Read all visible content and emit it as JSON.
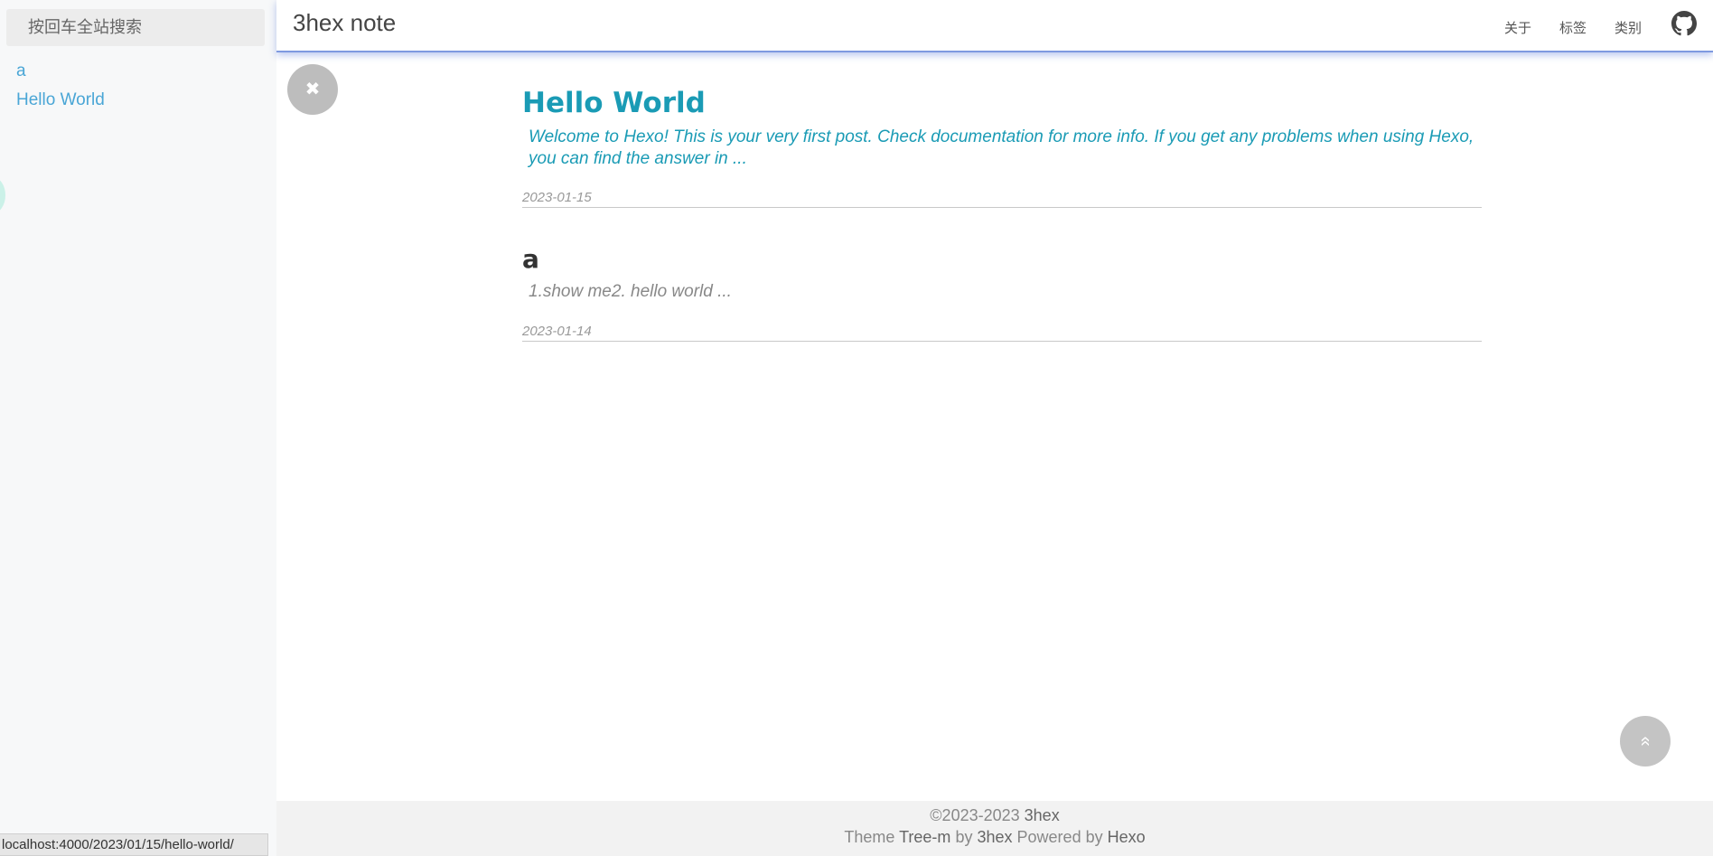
{
  "sidebar": {
    "search_placeholder": "按回车全站搜索",
    "items": [
      {
        "label": "a"
      },
      {
        "label": "Hello World"
      }
    ]
  },
  "header": {
    "site_title": "3hex note",
    "nav": [
      {
        "label": "关于"
      },
      {
        "label": "标签"
      },
      {
        "label": "类别"
      }
    ],
    "github_icon": "github-icon"
  },
  "close_button": {
    "icon": "close-icon",
    "glyph": "✖"
  },
  "posts": [
    {
      "title": "Hello World",
      "excerpt": "Welcome to Hexo! This is your very first post. Check documentation for more info. If you get any problems when using Hexo, you can find the answer in ...",
      "date": "2023-01-15",
      "color": "#1a9bb5"
    },
    {
      "title": "a",
      "excerpt": "1.show me2. hello world ...",
      "date": "2023-01-14",
      "color": "#333333"
    }
  ],
  "scroll_top": {
    "icon": "double-chevron-up-icon",
    "glyph": "»"
  },
  "footer": {
    "copyright": "©2023-2023",
    "author": "3hex",
    "theme_prefix": "Theme",
    "theme_name": "Tree-m",
    "by": "by",
    "theme_author": "3hex",
    "powered_by": "Powered by",
    "engine": "Hexo"
  },
  "status_bar": {
    "url": "localhost:4000/2023/01/15/hello-world/"
  },
  "colors": {
    "accent": "#1a9bb5",
    "sidebar_link": "#4aa6d6",
    "header_border": "#7f9ae0"
  }
}
